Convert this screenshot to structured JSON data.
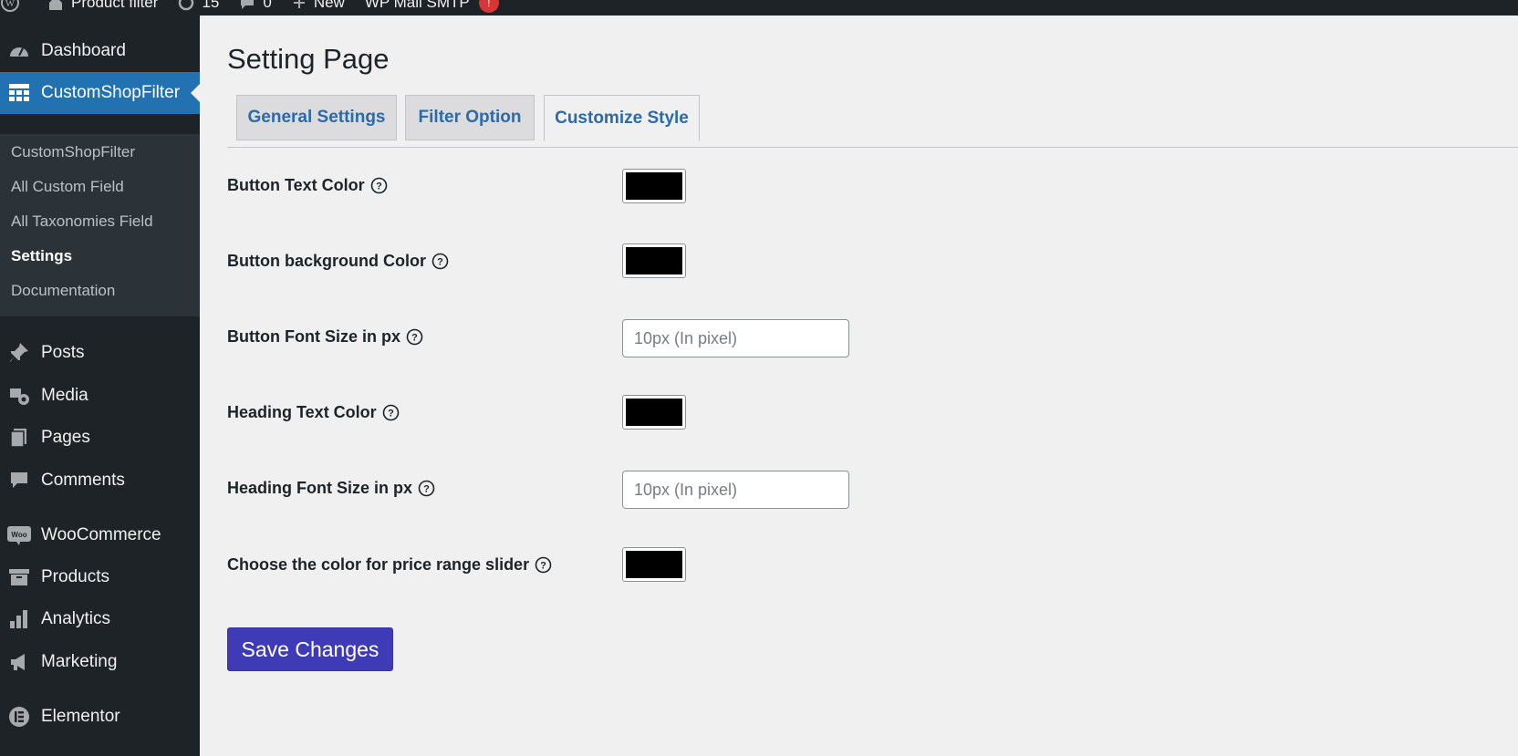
{
  "admin_bar": {
    "site_name": "Product filter",
    "updates_count": "15",
    "comments_count": "0",
    "new_label": "New",
    "plugin_label": "WP Mail SMTP",
    "notification_count": "!"
  },
  "sidebar": {
    "dashboard": "Dashboard",
    "current": "CustomShopFilter",
    "submenu": [
      "CustomShopFilter",
      "All Custom Field",
      "All Taxonomies Field",
      "Settings",
      "Documentation"
    ],
    "posts": "Posts",
    "media": "Media",
    "pages": "Pages",
    "comments": "Comments",
    "woocommerce": "WooCommerce",
    "products": "Products",
    "analytics": "Analytics",
    "marketing": "Marketing",
    "elementor": "Elementor"
  },
  "page": {
    "title": "Setting Page",
    "tabs": [
      "General Settings",
      "Filter Option",
      "Customize Style"
    ],
    "active_tab": "Customize Style"
  },
  "fields": {
    "button_text_color": {
      "label": "Button Text Color",
      "value": "#000000"
    },
    "button_bg_color": {
      "label": "Button background Color",
      "value": "#000000"
    },
    "button_font_size": {
      "label": "Button Font Size in px",
      "placeholder": "10px (In pixel)"
    },
    "heading_text_color": {
      "label": "Heading Text Color",
      "value": "#000000"
    },
    "heading_font_size": {
      "label": "Heading Font Size in px",
      "placeholder": "10px (In pixel)"
    },
    "price_slider_color": {
      "label": "Choose the color for price range slider",
      "value": "#000000"
    }
  },
  "save_button": "Save Changes",
  "colors": {
    "sidebar_bg": "#1d2327",
    "submenu_bg": "#2c3338",
    "accent": "#2271b1",
    "tab_link": "#2c6aa8",
    "save_button_bg": "#3f3ab5"
  }
}
